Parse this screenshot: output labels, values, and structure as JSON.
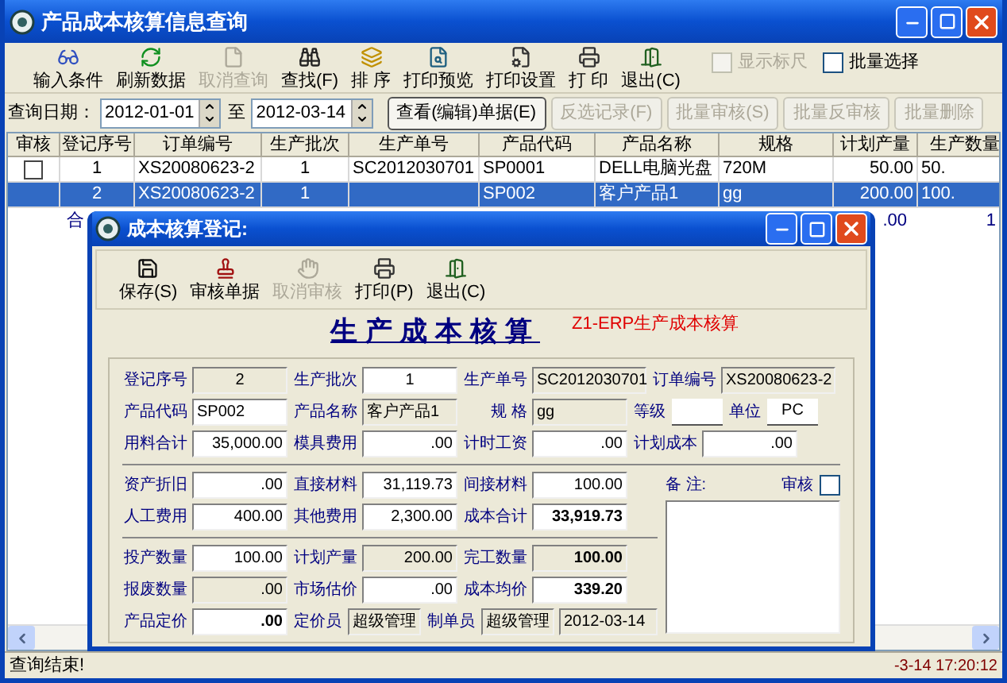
{
  "window": {
    "title": "产品成本核算信息查询"
  },
  "toolbar": [
    {
      "label": "输入条件",
      "disabled": false
    },
    {
      "label": "刷新数据",
      "disabled": false
    },
    {
      "label": "取消查询",
      "disabled": true
    },
    {
      "label": "查找(F)",
      "disabled": false
    },
    {
      "label": "排 序",
      "disabled": false
    },
    {
      "label": "打印预览",
      "disabled": false
    },
    {
      "label": "打印设置",
      "disabled": false
    },
    {
      "label": "打 印",
      "disabled": false
    },
    {
      "label": "退出(C)",
      "disabled": false
    }
  ],
  "toolbar_checks": [
    {
      "label": "显示标尺",
      "checked": false,
      "disabled": true
    },
    {
      "label": "批量选择",
      "checked": false,
      "disabled": false
    }
  ],
  "query": {
    "label": "查询日期：",
    "from": "2012-01-01",
    "separator": "至",
    "to": "2012-03-14"
  },
  "query_buttons": [
    {
      "label": "查看(编辑)单据(E)",
      "disabled": false
    },
    {
      "label": "反选记录(F)",
      "disabled": true
    },
    {
      "label": "批量审核(S)",
      "disabled": true
    },
    {
      "label": "批量反审核",
      "disabled": true
    },
    {
      "label": "批量删除",
      "disabled": true
    }
  ],
  "table": {
    "columns": [
      "审核",
      "登记序号",
      "订单编号",
      "生产批次",
      "生产单号",
      "产品代码",
      "产品名称",
      "规格",
      "计划产量",
      "生产数量"
    ],
    "rows": [
      {
        "checked": false,
        "selected": false,
        "cells": [
          "",
          "1",
          "XS20080623-2",
          "1",
          "SC2012030701",
          "SP0001",
          "DELL电脑光盘",
          "720M",
          "50.00",
          "50."
        ]
      },
      {
        "checked": false,
        "selected": true,
        "cells": [
          "",
          "2",
          "XS20080623-2",
          "1",
          "",
          "SP002",
          "客户产品1",
          "gg",
          "200.00",
          "100."
        ]
      }
    ],
    "totals": {
      "label": "合",
      "plan": ".00",
      "quantity": "1"
    }
  },
  "status_bar": {
    "message": "查询结束!",
    "time": "-3-14 17:20:12"
  },
  "dialog": {
    "title": "成本核算登记:",
    "toolbar": [
      {
        "label": "保存(S)",
        "disabled": false
      },
      {
        "label": "审核单据",
        "disabled": false
      },
      {
        "label": "取消审核",
        "disabled": true
      },
      {
        "label": "打印(P)",
        "disabled": false
      },
      {
        "label": "退出(C)",
        "disabled": false
      }
    ],
    "heading": "生产成本核算",
    "subtitle": "Z1-ERP生产成本核算",
    "top_rows": [
      [
        {
          "label": "登记序号",
          "value": "2",
          "kind": "centered",
          "readonly": true
        },
        {
          "label": "生产批次",
          "value": "1",
          "kind": "centered",
          "readonly": false
        },
        {
          "label": "生产单号",
          "value": "SC2012030701",
          "kind": "code",
          "readonly": true
        },
        {
          "label": "订单编号",
          "value": "XS20080623-2",
          "kind": "code",
          "readonly": true
        }
      ],
      [
        {
          "label": "产品代码",
          "value": "SP002",
          "kind": "text",
          "readonly": false
        },
        {
          "label": "产品名称",
          "value": "客户产品1",
          "kind": "text",
          "readonly": true
        },
        {
          "label": "规 格",
          "value": "gg",
          "kind": "text",
          "readonly": true
        },
        {
          "label": "等级",
          "kind": "underline"
        },
        {
          "label": "单位",
          "value": "PC",
          "kind": "underline"
        }
      ],
      [
        {
          "label": "用料合计",
          "value": "35,000.00",
          "kind": "number",
          "readonly": false
        },
        {
          "label": "模具费用",
          "value": ".00",
          "kind": "number",
          "readonly": false
        },
        {
          "label": "计时工资",
          "value": ".00",
          "kind": "number",
          "readonly": false
        },
        {
          "label": "计划成本",
          "value": ".00",
          "kind": "number",
          "readonly": false
        }
      ]
    ],
    "cost_rows": [
      [
        {
          "label": "资产折旧",
          "value": ".00",
          "kind": "number",
          "readonly": false
        },
        {
          "label": "直接材料",
          "value": "31,119.73",
          "kind": "number",
          "readonly": false
        },
        {
          "label": "间接材料",
          "value": "100.00",
          "kind": "number",
          "readonly": false
        }
      ],
      [
        {
          "label": "人工费用",
          "value": "400.00",
          "kind": "number",
          "readonly": false
        },
        {
          "label": "其他费用",
          "value": "2,300.00",
          "kind": "number",
          "readonly": false
        },
        {
          "label": "成本合计",
          "value": "33,919.73",
          "kind": "number",
          "readonly": false,
          "bold": true
        }
      ]
    ],
    "quantity_rows": [
      [
        {
          "label": "投产数量",
          "value": "100.00",
          "kind": "number",
          "readonly": false
        },
        {
          "label": "计划产量",
          "value": "200.00",
          "kind": "number",
          "readonly": true
        },
        {
          "label": "完工数量",
          "value": "100.00",
          "kind": "number",
          "readonly": true,
          "bold": true
        }
      ],
      [
        {
          "label": "报废数量",
          "value": ".00",
          "kind": "number",
          "readonly": true
        },
        {
          "label": "市场估价",
          "value": ".00",
          "kind": "number",
          "readonly": false
        },
        {
          "label": "成本均价",
          "value": "339.20",
          "kind": "number",
          "readonly": false,
          "bold": true
        }
      ],
      [
        {
          "label": "产品定价",
          "value": ".00",
          "kind": "number",
          "readonly": false,
          "bold": true
        },
        {
          "label": "定价员",
          "value": "超级管理",
          "kind": "short",
          "readonly": true
        },
        {
          "label": "制单员",
          "value": "超级管理",
          "kind": "short",
          "readonly": true
        },
        {
          "value": "2012-03-14",
          "kind": "date",
          "readonly": true
        }
      ]
    ],
    "remark_label": "备 注:",
    "audit": {
      "label": "审核",
      "checked": false
    }
  }
}
